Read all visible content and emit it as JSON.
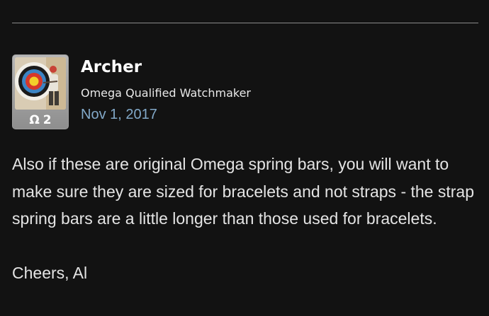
{
  "author": {
    "name": "Archer",
    "title": "Omega Qualified Watchmaker",
    "badge_symbol": "Ω",
    "badge_count": "2"
  },
  "post": {
    "date": "Nov 1, 2017",
    "paragraphs": [
      "Also if these are original Omega spring bars, you will want to make sure they are sized for bracelets and not straps - the strap spring bars are a little longer than those used for bracelets.",
      "Cheers, Al"
    ]
  },
  "colors": {
    "background": "#121212",
    "date_link": "#82a9c9",
    "text": "#e4e4e4"
  }
}
